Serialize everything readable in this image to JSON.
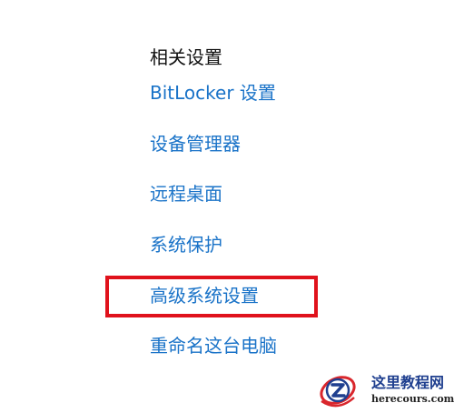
{
  "related_settings": {
    "title": "相关设置",
    "links": [
      "BitLocker 设置",
      "设备管理器",
      "远程桌面",
      "系统保护",
      "高级系统设置",
      "重命名这台电脑"
    ]
  },
  "highlight": {
    "target": "高级系统设置",
    "color": "#e0121c"
  },
  "watermark": {
    "name": "这里教程网",
    "url": "herecours.com",
    "logo_icon": "z-logo-icon"
  },
  "colors": {
    "link": "#1a73c8",
    "title": "#111111",
    "background": "#ffffff"
  }
}
